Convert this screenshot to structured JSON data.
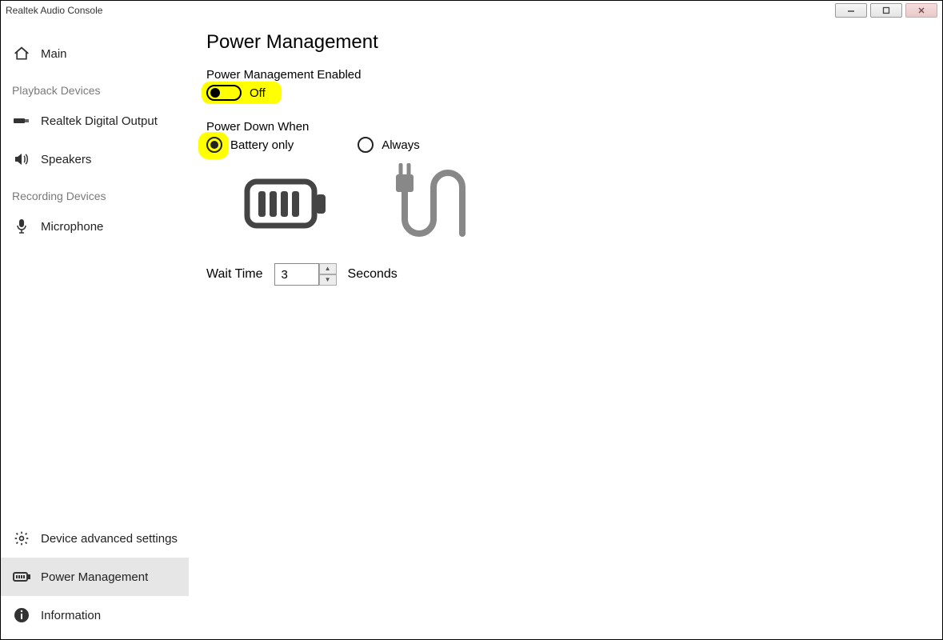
{
  "window": {
    "title": "Realtek Audio Console"
  },
  "sidebar": {
    "main": "Main",
    "groups": {
      "playback": "Playback Devices",
      "recording": "Recording Devices"
    },
    "items": {
      "digital_output": "Realtek Digital Output",
      "speakers": "Speakers",
      "microphone": "Microphone"
    },
    "bottom": {
      "advanced": "Device advanced settings",
      "power": "Power Management",
      "info": "Information"
    }
  },
  "content": {
    "title": "Power Management",
    "pm_enabled_label": "Power Management Enabled",
    "toggle_state": "Off",
    "power_down_label": "Power Down When",
    "radio_battery": "Battery only",
    "radio_always": "Always",
    "wait_label": "Wait Time",
    "wait_value": "3",
    "wait_unit": "Seconds"
  }
}
